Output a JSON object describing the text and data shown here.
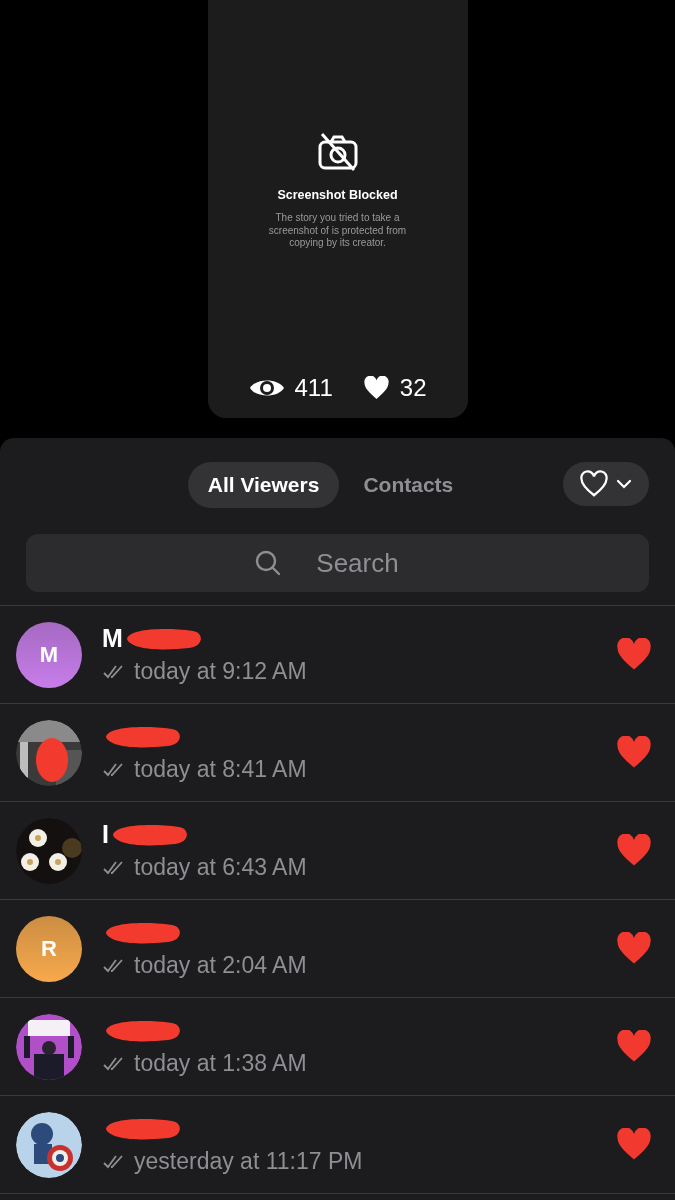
{
  "story": {
    "title": "Screenshot Blocked",
    "message": "The story you tried to take a screenshot of is protected from copying by its creator.",
    "views": "411",
    "likes": "32"
  },
  "tabs": [
    {
      "label": "All Viewers",
      "selected": true
    },
    {
      "label": "Contacts",
      "selected": false
    }
  ],
  "search": {
    "placeholder": "Search"
  },
  "viewers": [
    {
      "name": "M",
      "avatar": {
        "kind": "initial",
        "letter": "M",
        "color": "#c77dea"
      },
      "time": "today at 9:12 AM",
      "liked": true
    },
    {
      "time": "today at 8:41 AM",
      "liked": true
    },
    {
      "name": "I",
      "time": "today at 6:43 AM",
      "liked": true
    },
    {
      "avatar": {
        "kind": "initial",
        "letter": "R",
        "color": "#f7a94c"
      },
      "time": "today at 2:04 AM",
      "liked": true
    },
    {
      "time": "today at 1:38 AM",
      "liked": true
    },
    {
      "time": "yesterday at 11:17 PM",
      "liked": true
    }
  ]
}
